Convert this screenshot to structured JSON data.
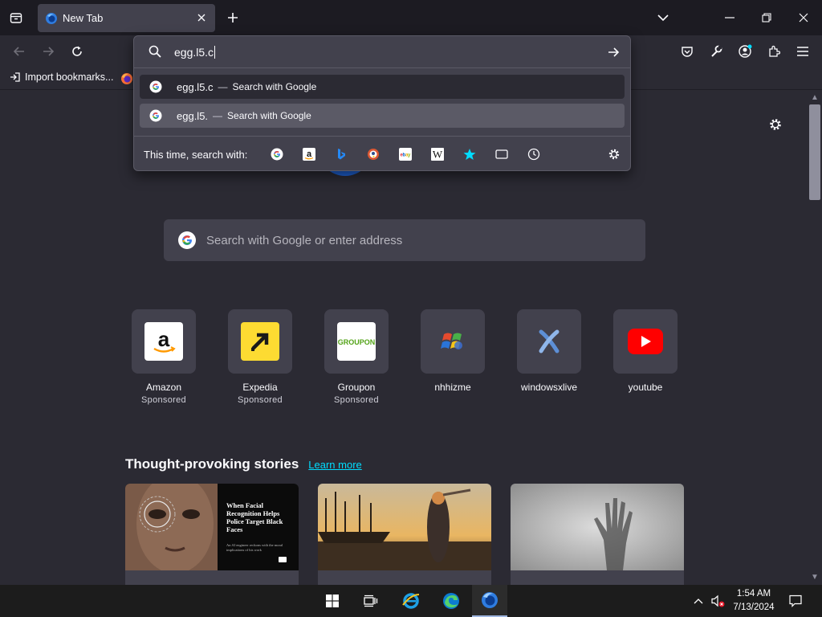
{
  "tab": {
    "title": "New Tab"
  },
  "bookmarks": {
    "import_label": "Import bookmarks..."
  },
  "urlbar": {
    "value": "egg.l5.c",
    "results": [
      {
        "text": "egg.l5.c",
        "action": "Search with Google"
      },
      {
        "text": "egg.l5.",
        "action": "Search with Google"
      }
    ],
    "one_off_label": "This time, search with:",
    "engines": [
      "Google",
      "Amazon",
      "Bing",
      "DuckDuckGo",
      "eBay",
      "Wikipedia",
      "Bookmarks",
      "Tabs",
      "History"
    ]
  },
  "newtab": {
    "search_placeholder": "Search with Google or enter address",
    "tiles": [
      {
        "label": "Amazon",
        "sponsor": "Sponsored"
      },
      {
        "label": "Expedia",
        "sponsor": "Sponsored"
      },
      {
        "label": "Groupon",
        "sponsor": "Sponsored"
      },
      {
        "label": "nhhizme",
        "sponsor": ""
      },
      {
        "label": "windowsxlive",
        "sponsor": ""
      },
      {
        "label": "youtube",
        "sponsor": ""
      }
    ],
    "stories_title": "Thought-provoking stories",
    "stories_link": "Learn more",
    "story1_headline": "When Facial Recognition Helps Police Target Black Faces",
    "story1_sub": "An AI engineer reckons with the moral implications of his work"
  },
  "taskbar": {
    "time": "1:54 AM",
    "date": "7/13/2024"
  },
  "colors": {
    "accent": "#00ddff",
    "chrome": "#1c1b22",
    "toolbar": "#2b2a33",
    "panel": "#42414d"
  }
}
